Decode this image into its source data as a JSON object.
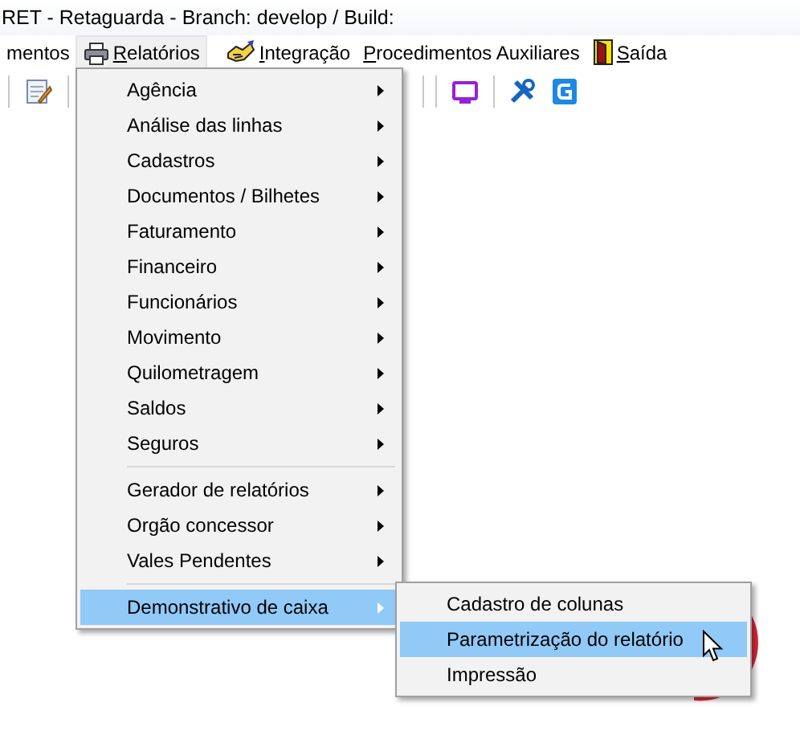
{
  "window": {
    "title": "RET - Retaguarda - Branch: develop / Build:"
  },
  "menu_bar": [
    {
      "label": "mentos",
      "selected": false,
      "mnemonic": false
    },
    {
      "label": "Relatórios",
      "selected": true,
      "mnemonic": true
    },
    {
      "label": "Integração",
      "selected": false,
      "mnemonic": true
    },
    {
      "label": "Procedimentos Auxiliares",
      "selected": false,
      "mnemonic": true
    },
    {
      "label": "Saída",
      "selected": false,
      "mnemonic": true
    }
  ],
  "menu": {
    "items": [
      {
        "kind": "item",
        "label": "Agência",
        "submenu": true,
        "selected": false
      },
      {
        "kind": "item",
        "label": "Análise das linhas",
        "submenu": true,
        "selected": false
      },
      {
        "kind": "item",
        "label": "Cadastros",
        "submenu": true,
        "selected": false
      },
      {
        "kind": "item",
        "label": "Documentos / Bilhetes",
        "submenu": true,
        "selected": false
      },
      {
        "kind": "item",
        "label": "Faturamento",
        "submenu": true,
        "selected": false
      },
      {
        "kind": "item",
        "label": "Financeiro",
        "submenu": true,
        "selected": false
      },
      {
        "kind": "item",
        "label": "Funcionários",
        "submenu": true,
        "selected": false
      },
      {
        "kind": "item",
        "label": "Movimento",
        "submenu": true,
        "selected": false
      },
      {
        "kind": "item",
        "label": "Quilometragem",
        "submenu": true,
        "selected": false
      },
      {
        "kind": "item",
        "label": "Saldos",
        "submenu": true,
        "selected": false
      },
      {
        "kind": "item",
        "label": "Seguros",
        "submenu": true,
        "selected": false
      },
      {
        "kind": "separator"
      },
      {
        "kind": "item",
        "label": "Gerador de relatórios",
        "submenu": true,
        "selected": false
      },
      {
        "kind": "item",
        "label": "Orgão concessor",
        "submenu": true,
        "selected": false
      },
      {
        "kind": "item",
        "label": "Vales Pendentes",
        "submenu": true,
        "selected": false
      },
      {
        "kind": "separator"
      },
      {
        "kind": "item",
        "label": "Demonstrativo de caixa",
        "submenu": true,
        "selected": true
      }
    ]
  },
  "submenu": {
    "items": [
      {
        "kind": "item",
        "label": "Cadastro de colunas",
        "submenu": false,
        "selected": false
      },
      {
        "kind": "item",
        "label": "Parametrização do relatório",
        "submenu": false,
        "selected": true
      },
      {
        "kind": "item",
        "label": "Impressão",
        "submenu": false,
        "selected": false
      }
    ]
  }
}
